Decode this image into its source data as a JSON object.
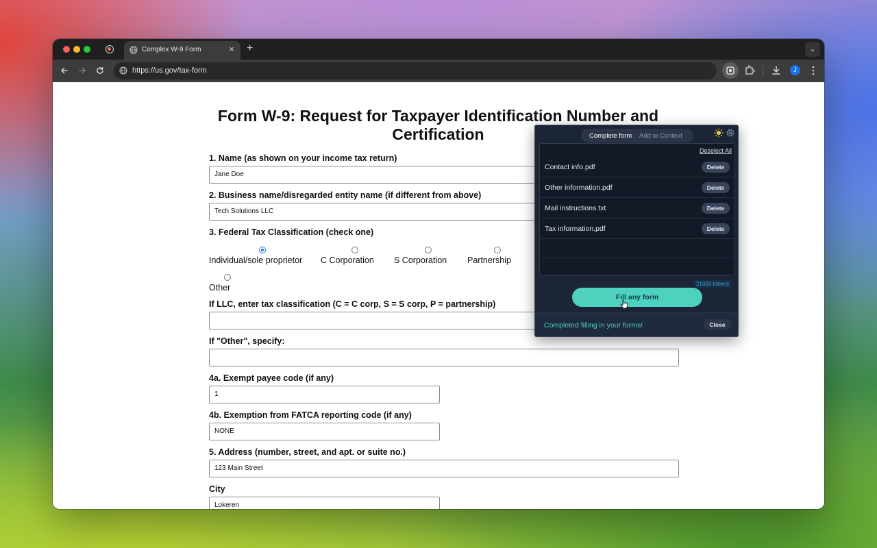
{
  "browser": {
    "tab_title": "Complex W-9 Form",
    "tab_close": "×",
    "new_tab": "+",
    "url": "https://us.gov/tax-form",
    "avatar_initial": "J",
    "tab_menu_glyph": "⌄"
  },
  "form": {
    "title": "Form W-9: Request for Taxpayer Identification Number and Certification",
    "name_label": "1. Name (as shown on your income tax return)",
    "name_value": "Jane Doe",
    "business_label": "2. Business name/disregarded entity name (if different from above)",
    "business_value": "Tech Solutions LLC",
    "classification_label": "3. Federal Tax Classification (check one)",
    "classifications": [
      {
        "label": "Individual/sole proprietor",
        "checked": true
      },
      {
        "label": "C Corporation",
        "checked": false
      },
      {
        "label": "S Corporation",
        "checked": false
      },
      {
        "label": "Partnership",
        "checked": false
      },
      {
        "label": "Other",
        "checked": false
      }
    ],
    "llc_label": "If LLC, enter tax classification (C = C corp, S = S corp, P = partnership)",
    "llc_value": "",
    "other_label": "If \"Other\", specify:",
    "other_value": "",
    "exempt_label": "4a. Exempt payee code (if any)",
    "exempt_value": "1",
    "fatca_label": "4b. Exemption from FATCA reporting code (if any)",
    "fatca_value": "NONE",
    "address_label": "5. Address (number, street, and apt. or suite no.)",
    "address_value": "123 Main Street",
    "city_label": "City",
    "city_value": "Lokeren"
  },
  "extension": {
    "tab_complete": "Complete form",
    "tab_context": "Add to Context",
    "deselect_all": "Deselect All",
    "files": [
      {
        "name": "Contact info.pdf",
        "action": "Delete"
      },
      {
        "name": "Other information.pdf",
        "action": "Delete"
      },
      {
        "name": "Mail instructions.txt",
        "action": "Delete"
      },
      {
        "name": "Tax information.pdf",
        "action": "Delete"
      }
    ],
    "tokens": "21026 tokens",
    "fill_button": "Fill any form",
    "status": "Completed filling in your forms!",
    "close_button": "Close"
  },
  "colors": {
    "accent_teal": "#4fd1c0",
    "radio_blue": "#1a73e8",
    "popup_bg": "#1b2536"
  }
}
